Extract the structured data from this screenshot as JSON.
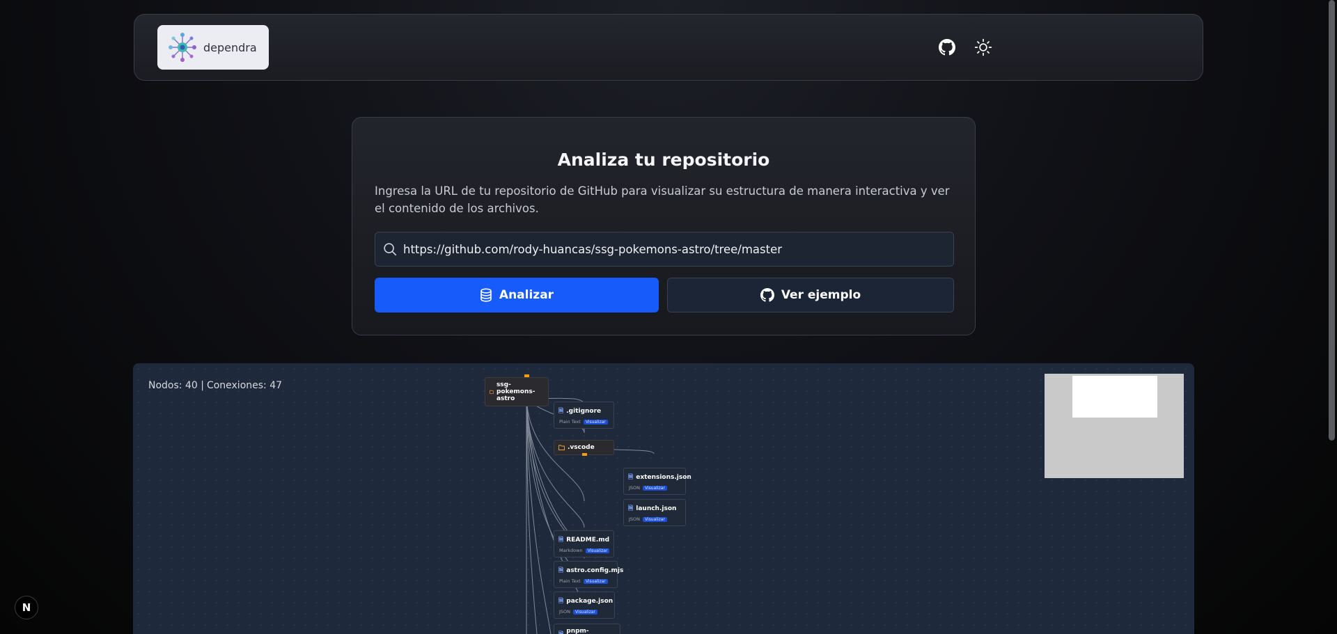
{
  "header": {
    "logo_text": "dependra",
    "github_icon": "github-icon",
    "theme_icon": "sun-icon"
  },
  "analyze": {
    "title": "Analiza tu repositorio",
    "description": "Ingresa la URL de tu repositorio de GitHub para visualizar su estructura de manera interactiva y ver el contenido de los archivos.",
    "url_value": "https://github.com/rody-huancas/ssg-pokemons-astro/tree/master",
    "analyze_label": "Analizar",
    "example_label": "Ver ejemplo"
  },
  "graph": {
    "nodes_label": "Nodos: 40 |",
    "connections_label": "Conexiones: 47",
    "root": "ssg-pokemons-astro",
    "view_badge": "Visualizar",
    "items": [
      {
        "name": ".gitignore",
        "type": "Plain Text",
        "kind": "file"
      },
      {
        "name": ".vscode",
        "type": "",
        "kind": "folder"
      },
      {
        "name": "extensions.json",
        "type": "JSON",
        "kind": "file"
      },
      {
        "name": "launch.json",
        "type": "JSON",
        "kind": "file"
      },
      {
        "name": "README.md",
        "type": "Markdown",
        "kind": "file"
      },
      {
        "name": "astro.config.mjs",
        "type": "Plain Text",
        "kind": "file"
      },
      {
        "name": "package.json",
        "type": "JSON",
        "kind": "file"
      },
      {
        "name": "pnpm-lock.yaml",
        "type": "",
        "kind": "file"
      }
    ]
  },
  "devtools": {
    "label": "N"
  },
  "colors": {
    "accent": "#175bfb",
    "canvas": "#1e293b",
    "handle": "#f59e0b"
  }
}
